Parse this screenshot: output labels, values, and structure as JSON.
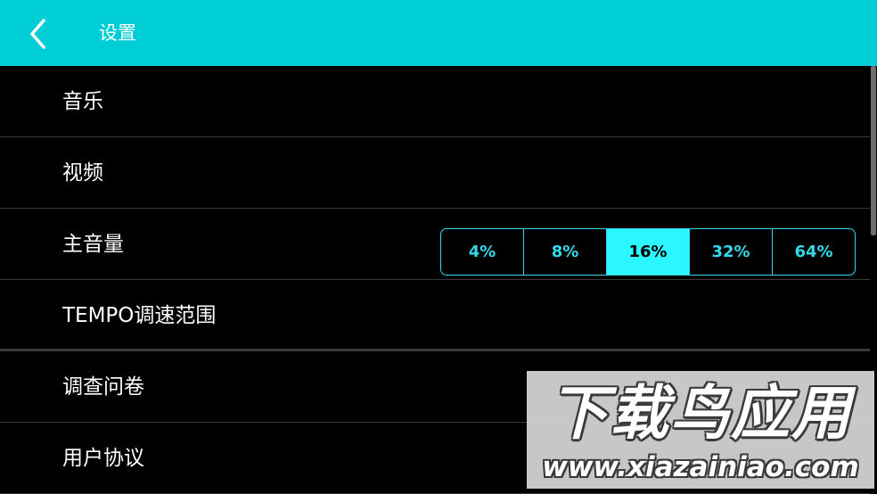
{
  "header": {
    "title": "设置",
    "back_icon": "chevron-left-icon",
    "background_color": "#00CED6"
  },
  "settings": {
    "items": [
      {
        "label": "音乐"
      },
      {
        "label": "视频"
      },
      {
        "label": "主音量"
      },
      {
        "label": "TEMPO调速范围"
      },
      {
        "label": "调查问卷"
      },
      {
        "label": "用户协议"
      }
    ]
  },
  "tempo_range": {
    "options": [
      "4%",
      "8%",
      "16%",
      "32%",
      "64%"
    ],
    "selected": "16%",
    "accent_color": "#33D9E8",
    "selected_color": "#2CF6FF"
  },
  "watermark": {
    "title": "下载鸟应用",
    "url": "www.xiazainiao.com"
  }
}
